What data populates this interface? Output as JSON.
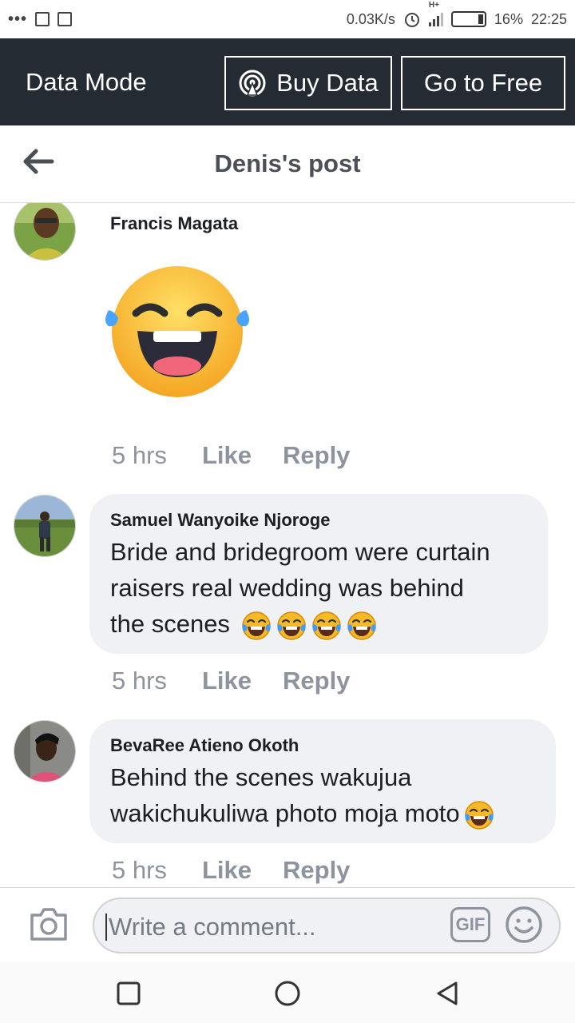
{
  "status_bar": {
    "dots": "•••",
    "net_speed": "0.03K/s",
    "network_type": "H+",
    "battery": "16%",
    "time": "22:25"
  },
  "data_bar": {
    "title": "Data Mode",
    "buy_label": "Buy Data",
    "free_label": "Go to Free"
  },
  "header": {
    "title": "Denis's post"
  },
  "comments": [
    {
      "author": "Francis Magata",
      "text": "",
      "sticker": "laughing-face-sticker",
      "time": "5 hrs",
      "like": "Like",
      "reply": "Reply"
    },
    {
      "author": "Samuel Wanyoike Njoroge",
      "lines": [
        "Bride and bridegroom were curtain",
        "raisers real wedding was behind",
        "the scenes "
      ],
      "emoji_count": 4,
      "time": "5 hrs",
      "like": "Like",
      "reply": "Reply"
    },
    {
      "author": "BevaRee Atieno Okoth",
      "lines": [
        "Behind the scenes wakujua",
        "wakichukuliwa photo moja moto"
      ],
      "emoji_count": 1,
      "time": "5 hrs",
      "like": "Like",
      "reply": "Reply"
    }
  ],
  "composer": {
    "placeholder": "Write a comment...",
    "gif_label": "GIF"
  },
  "colors": {
    "data_bar_bg": "#252b33",
    "bubble_bg": "#f0f1f4",
    "meta_text": "#8d949e",
    "emoji_yellow": "#f7b928"
  }
}
